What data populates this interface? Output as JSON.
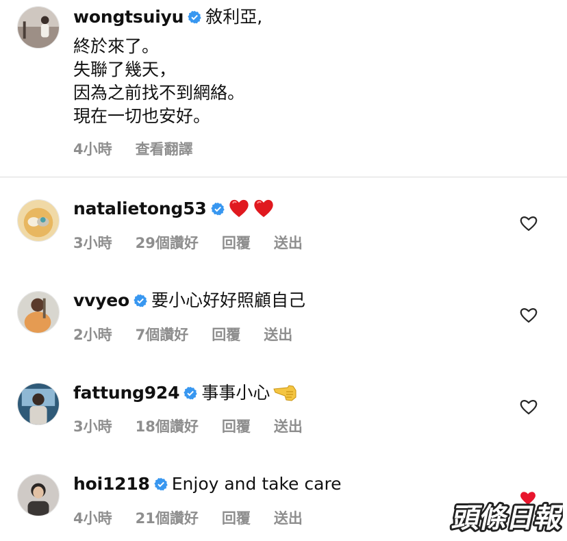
{
  "post": {
    "username": "wongtsuiyu",
    "verified": true,
    "caption_lines": [
      "敘利亞,",
      "終於來了。",
      "失聯了幾天，",
      "因為之前找不到網絡。",
      "現在一切也安好。"
    ],
    "time": "4小時",
    "translate_label": "查看翻譯"
  },
  "comments": [
    {
      "username": "natalietong53",
      "verified": true,
      "text": "",
      "emoji": [
        "red-heart",
        "red-heart"
      ],
      "time": "3小時",
      "likes": "29個讚好",
      "reply": "回覆",
      "send": "送出"
    },
    {
      "username": "vvyeo",
      "verified": true,
      "text": "要小心好好照顧自己",
      "time": "2小時",
      "likes": "7個讚好",
      "reply": "回覆",
      "send": "送出"
    },
    {
      "username": "fattung924",
      "verified": true,
      "text": "事事小心",
      "emoji": [
        "pointing-hand"
      ],
      "time": "3小時",
      "likes": "18個讚好",
      "reply": "回覆",
      "send": "送出"
    },
    {
      "username": "hoi1218",
      "verified": true,
      "text": "Enjoy and take care",
      "time": "4小時",
      "likes": "21個讚好",
      "reply": "回覆",
      "send": "送出"
    }
  ],
  "watermark": {
    "text": "頭條日報"
  },
  "colors": {
    "verified": "#3897f0",
    "meta": "#8e8e8e",
    "heart_emoji": "#e0191f",
    "watermark_heart": "#e8152d"
  },
  "icons": {
    "verified": "verified-badge-icon",
    "like": "heart-outline-icon"
  }
}
